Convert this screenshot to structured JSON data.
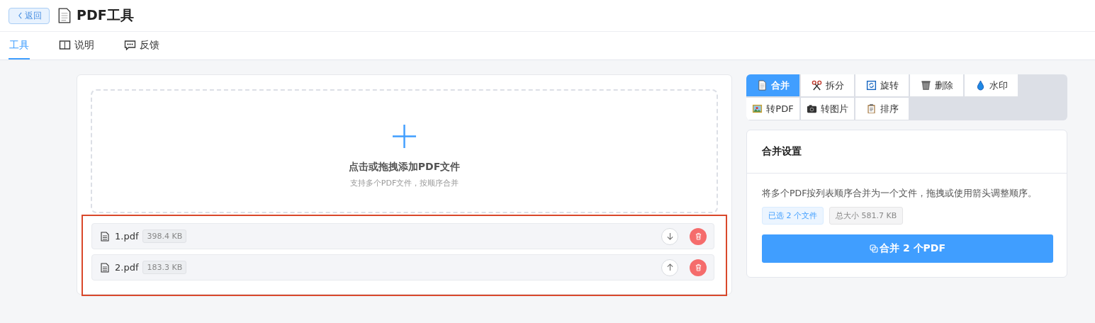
{
  "header": {
    "back_button": "返回",
    "title": "PDF工具"
  },
  "nav_tabs": [
    {
      "label": "工具",
      "selected": true
    },
    {
      "label": "说明",
      "selected": false
    },
    {
      "label": "反馈",
      "selected": false
    }
  ],
  "dropzone": {
    "title": "点击或拖拽添加PDF文件",
    "hint": "支持多个PDF文件，按顺序合并"
  },
  "file_list": {
    "highlighted": true,
    "files": [
      {
        "name": "1.pdf",
        "size": "398.4 KB",
        "kind": "down"
      },
      {
        "name": "2.pdf",
        "size": "183.3 KB",
        "kind": "up"
      }
    ]
  },
  "tool_tabs": [
    {
      "label": "合并",
      "selected": true
    },
    {
      "label": "拆分",
      "selected": false
    },
    {
      "label": "旋转",
      "selected": false
    },
    {
      "label": "删除",
      "selected": false
    },
    {
      "label": "水印",
      "selected": false
    },
    {
      "label": "转PDF",
      "selected": false
    },
    {
      "label": "转图片",
      "selected": false
    },
    {
      "label": "排序",
      "selected": false
    }
  ],
  "settings": {
    "title": "合并设置",
    "description": "将多个PDF按列表顺序合并为一个文件，拖拽或使用箭头调整顺序。",
    "tags": [
      "已选 2 个文件",
      "总大小 581.7 KB"
    ],
    "action_button": "合并 2 个PDF"
  }
}
